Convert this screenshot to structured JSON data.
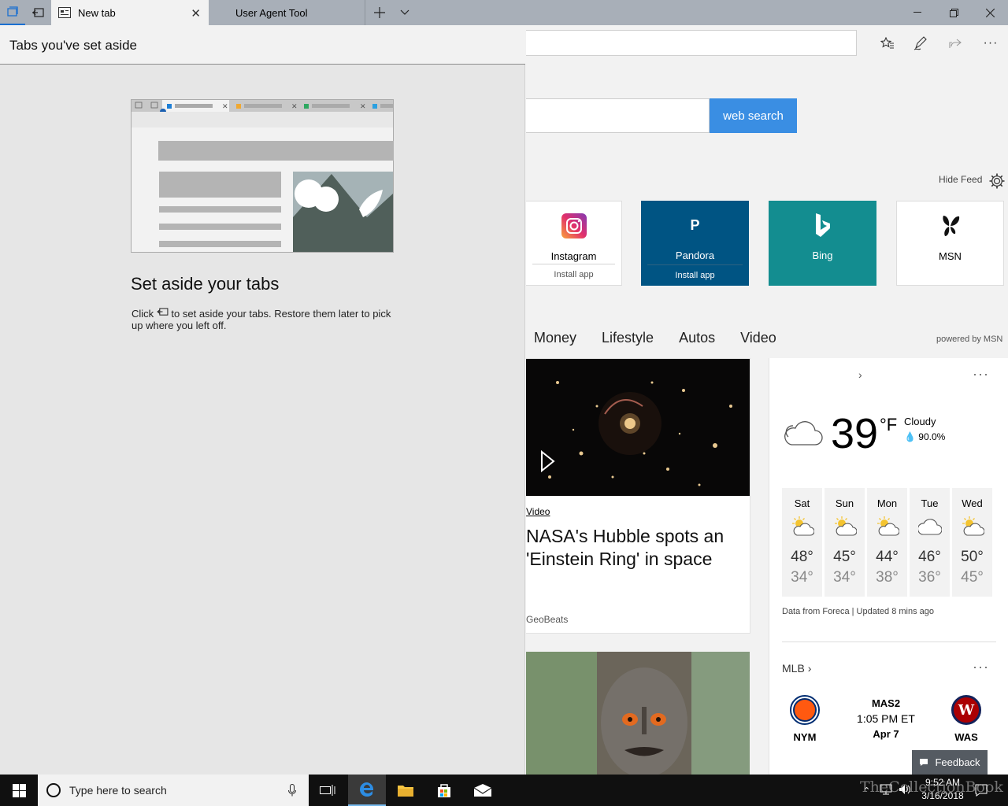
{
  "browser": {
    "tabs": [
      {
        "label": "New tab",
        "active": true
      },
      {
        "label": "User Agent Tool",
        "active": false
      }
    ]
  },
  "aside_panel": {
    "title": "Tabs you've set aside",
    "heading": "Set aside your tabs",
    "desc_prefix": "Click",
    "desc_suffix": "to set aside your tabs. Restore them later to pick up where you left off."
  },
  "page": {
    "search_button": "web search",
    "hide_feed": "Hide Feed",
    "tiles": [
      {
        "name": "Instagram",
        "install": "Install app",
        "bg": "#ffffff"
      },
      {
        "name": "Pandora",
        "install": "Install app",
        "bg": "#005483",
        "glyph": "P"
      },
      {
        "name": "Bing",
        "bg": "#138d90"
      },
      {
        "name": "MSN",
        "bg": "#ffffff"
      }
    ],
    "categories": [
      "Money",
      "Lifestyle",
      "Autos",
      "Video"
    ],
    "powered_by": "powered by MSN",
    "news": {
      "tag": "Video",
      "title": "NASA's Hubble spots an 'Einstein Ring' in space",
      "source": "GeoBeats"
    },
    "weather": {
      "temp": "39",
      "unit": "°F",
      "condition": "Cloudy",
      "precip": "90.0%",
      "forecast": [
        {
          "day": "Sat",
          "hi": "48°",
          "lo": "34°",
          "icon": "sun-cloud"
        },
        {
          "day": "Sun",
          "hi": "45°",
          "lo": "34°",
          "icon": "sun-cloud"
        },
        {
          "day": "Mon",
          "hi": "44°",
          "lo": "38°",
          "icon": "sun-cloud"
        },
        {
          "day": "Tue",
          "hi": "46°",
          "lo": "36°",
          "icon": "cloud"
        },
        {
          "day": "Wed",
          "hi": "50°",
          "lo": "45°",
          "icon": "sun-cloud"
        }
      ],
      "source": "Data from Foreca | Updated 8 mins ago"
    },
    "mlb": {
      "title": "MLB",
      "home": "NYM",
      "away": "WAS",
      "network": "MAS2",
      "time": "1:05 PM ET",
      "date": "Apr 7"
    },
    "feedback": "Feedback"
  },
  "taskbar": {
    "search_placeholder": "Type here to search",
    "time": "9:52 AM",
    "date": "3/16/2018"
  },
  "watermark": "TheCollectionBook",
  "colors": {
    "accent": "#3a8ee3",
    "titlebar": "#a8afb8",
    "taskbar": "#101010"
  }
}
